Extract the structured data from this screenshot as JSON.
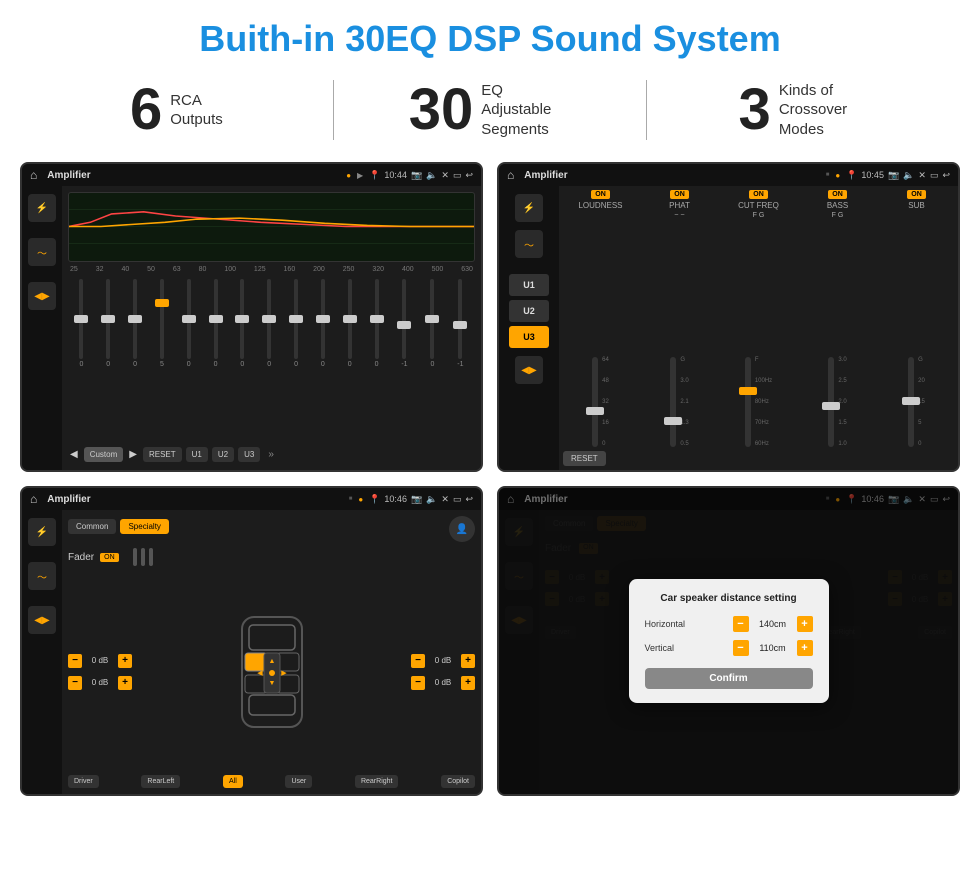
{
  "page": {
    "title": "Buith-in 30EQ DSP Sound System"
  },
  "stats": [
    {
      "number": "6",
      "label": "RCA\nOutputs"
    },
    {
      "number": "30",
      "label": "EQ Adjustable\nSegments"
    },
    {
      "number": "3",
      "label": "Kinds of\nCrossover Modes"
    }
  ],
  "screens": {
    "eq": {
      "app_name": "Amplifier",
      "time": "10:44",
      "freqs": [
        "25",
        "32",
        "40",
        "50",
        "63",
        "80",
        "100",
        "125",
        "160",
        "200",
        "250",
        "320",
        "400",
        "500",
        "630"
      ],
      "values": [
        "0",
        "0",
        "0",
        "5",
        "0",
        "0",
        "0",
        "0",
        "0",
        "0",
        "0",
        "0",
        "-1",
        "0",
        "-1"
      ],
      "mode": "Custom",
      "buttons": [
        "RESET",
        "U1",
        "U2",
        "U3"
      ]
    },
    "dsp": {
      "app_name": "Amplifier",
      "time": "10:45",
      "presets": [
        "U1",
        "U2",
        "U3"
      ],
      "active_preset": "U3",
      "channels": [
        "LOUDNESS",
        "PHAT",
        "CUT FREQ",
        "BASS",
        "SUB"
      ],
      "reset_label": "RESET"
    },
    "fader": {
      "app_name": "Amplifier",
      "time": "10:46",
      "tabs": [
        "Common",
        "Specialty"
      ],
      "active_tab": "Specialty",
      "fader_label": "Fader",
      "fader_on": "ON",
      "volumes": [
        {
          "val": "0 dB",
          "side": "left"
        },
        {
          "val": "0 dB",
          "side": "left"
        },
        {
          "val": "0 dB",
          "side": "right"
        },
        {
          "val": "0 dB",
          "side": "right"
        }
      ],
      "locations": [
        "Driver",
        "RearLeft",
        "All",
        "User",
        "RearRight",
        "Copilot"
      ]
    },
    "dialog": {
      "app_name": "Amplifier",
      "time": "10:46",
      "tabs": [
        "Common",
        "Specialty"
      ],
      "active_tab": "Specialty",
      "dialog_title": "Car speaker distance setting",
      "horizontal_label": "Horizontal",
      "horizontal_val": "140cm",
      "vertical_label": "Vertical",
      "vertical_val": "110cm",
      "confirm_label": "Confirm",
      "locations": [
        "Driver",
        "RearLeft",
        "All",
        "User",
        "RearRight",
        "Copilot"
      ]
    }
  }
}
